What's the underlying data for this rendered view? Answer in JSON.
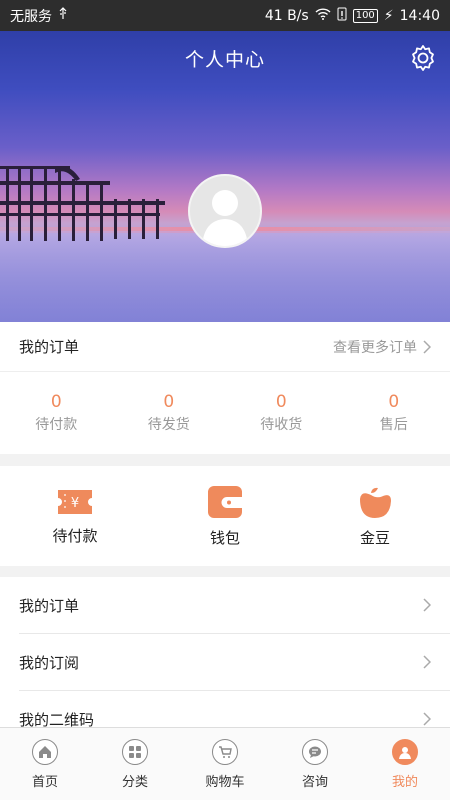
{
  "status_bar": {
    "carrier": "无服务",
    "speed": "41 B/s",
    "battery": "100",
    "time": "14:40"
  },
  "header": {
    "title": "个人中心"
  },
  "orders": {
    "title": "我的订单",
    "more": "查看更多订单",
    "stats": [
      {
        "count": "0",
        "label": "待付款"
      },
      {
        "count": "0",
        "label": "待发货"
      },
      {
        "count": "0",
        "label": "待收货"
      },
      {
        "count": "0",
        "label": "售后"
      }
    ]
  },
  "quick_actions": [
    {
      "label": "待付款",
      "icon": "ticket-yen-icon"
    },
    {
      "label": "钱包",
      "icon": "wallet-icon"
    },
    {
      "label": "金豆",
      "icon": "bean-icon"
    }
  ],
  "menu": [
    {
      "label": "我的订单"
    },
    {
      "label": "我的订阅"
    },
    {
      "label": "我的二维码"
    }
  ],
  "tabs": [
    {
      "label": "首页",
      "icon": "home-icon"
    },
    {
      "label": "分类",
      "icon": "category-icon"
    },
    {
      "label": "购物车",
      "icon": "cart-icon"
    },
    {
      "label": "咨询",
      "icon": "chat-icon"
    },
    {
      "label": "我的",
      "icon": "profile-icon"
    }
  ],
  "colors": {
    "accent": "#f08a5d",
    "muted": "#999999"
  }
}
